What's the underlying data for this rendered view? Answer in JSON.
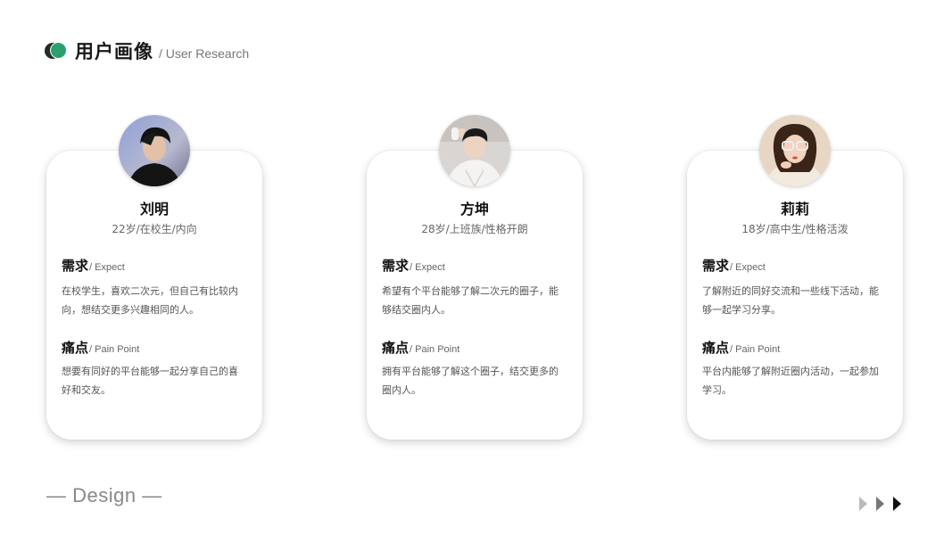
{
  "header": {
    "title": "用户画像",
    "subtitle": "/ User  Research"
  },
  "cards": [
    {
      "name": "刘明",
      "meta": "22岁/在校生/内向",
      "need_title": "需求",
      "need_en": "/ Expect",
      "need_text": "在校学生，喜欢二次元，但自己有比较内向，想结交更多兴趣相同的人。",
      "pain_title": "痛点",
      "pain_en": "/ Pain Point",
      "pain_text": "想要有同好的平台能够一起分享自己的喜好和交友。"
    },
    {
      "name": "方坤",
      "meta": "28岁/上班族/性格开朗",
      "need_title": "需求",
      "need_en": "/ Expect",
      "need_text": "希望有个平台能够了解二次元的圈子，能够结交圈内人。",
      "pain_title": "痛点",
      "pain_en": "/ Pain Point",
      "pain_text": "拥有平台能够了解这个圈子，结交更多的圈内人。"
    },
    {
      "name": "莉莉",
      "meta": "18岁/高中生/性格活泼",
      "need_title": "需求",
      "need_en": "/ Expect",
      "need_text": "了解附近的同好交流和一些线下活动，能够一起学习分享。",
      "pain_title": "痛点",
      "pain_en": "/ Pain Point",
      "pain_text": "平台内能够了解附近圈内活动，一起参加学习。"
    }
  ],
  "footer": {
    "label": "— Design —"
  },
  "colors": {
    "accent": "#2aa06f",
    "logo_dark": "#1f2d2a"
  },
  "icons": [
    "logo-mark-icon",
    "arrow-right-icon"
  ]
}
